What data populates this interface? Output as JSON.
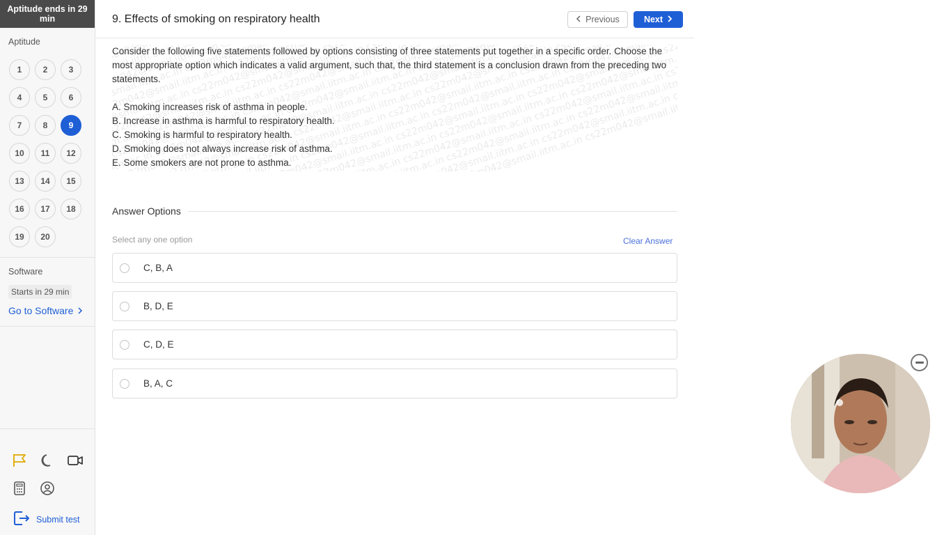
{
  "sidebar": {
    "timer_text": "Aptitude ends in 29 min",
    "aptitude_label": "Aptitude",
    "questions": [
      "1",
      "2",
      "3",
      "4",
      "5",
      "6",
      "7",
      "8",
      "9",
      "10",
      "11",
      "12",
      "13",
      "14",
      "15",
      "16",
      "17",
      "18",
      "19",
      "20"
    ],
    "current_question": "9",
    "software_label": "Software",
    "software_starts": "Starts in 29 min",
    "go_to_software": "Go to Software",
    "submit_label": "Submit test",
    "tools": [
      "flag-icon",
      "moon-icon",
      "video-camera-icon",
      "calculator-icon",
      "user-circle-icon"
    ]
  },
  "header": {
    "question_title": "9. Effects of smoking on respiratory health",
    "previous_label": "Previous",
    "next_label": "Next"
  },
  "question": {
    "intro": "Consider the following five statements followed by options consisting of three statements put together in a specific order. Choose the most appropriate option which indicates a valid argument, such that, the third statement is a conclusion drawn from the preceding two statements.",
    "statements": [
      "A. Smoking increases risk of asthma in people.",
      "B. Increase in asthma is harmful to respiratory health.",
      "C. Smoking is harmful to respiratory health.",
      "D. Smoking does not always increase risk of asthma.",
      "E. Some smokers are not prone to asthma."
    ],
    "watermark": "cs22m042@smail.iitm.ac.in"
  },
  "answers": {
    "heading": "Answer Options",
    "hint": "Select any one option",
    "clear_label": "Clear Answer",
    "options": [
      "C, B, A",
      "B, D, E",
      "C, D, E",
      "B, A, C"
    ]
  },
  "colors": {
    "accent": "#1f5fd6",
    "timer_bg": "#4a4a4a",
    "flag": "#e0a800"
  }
}
